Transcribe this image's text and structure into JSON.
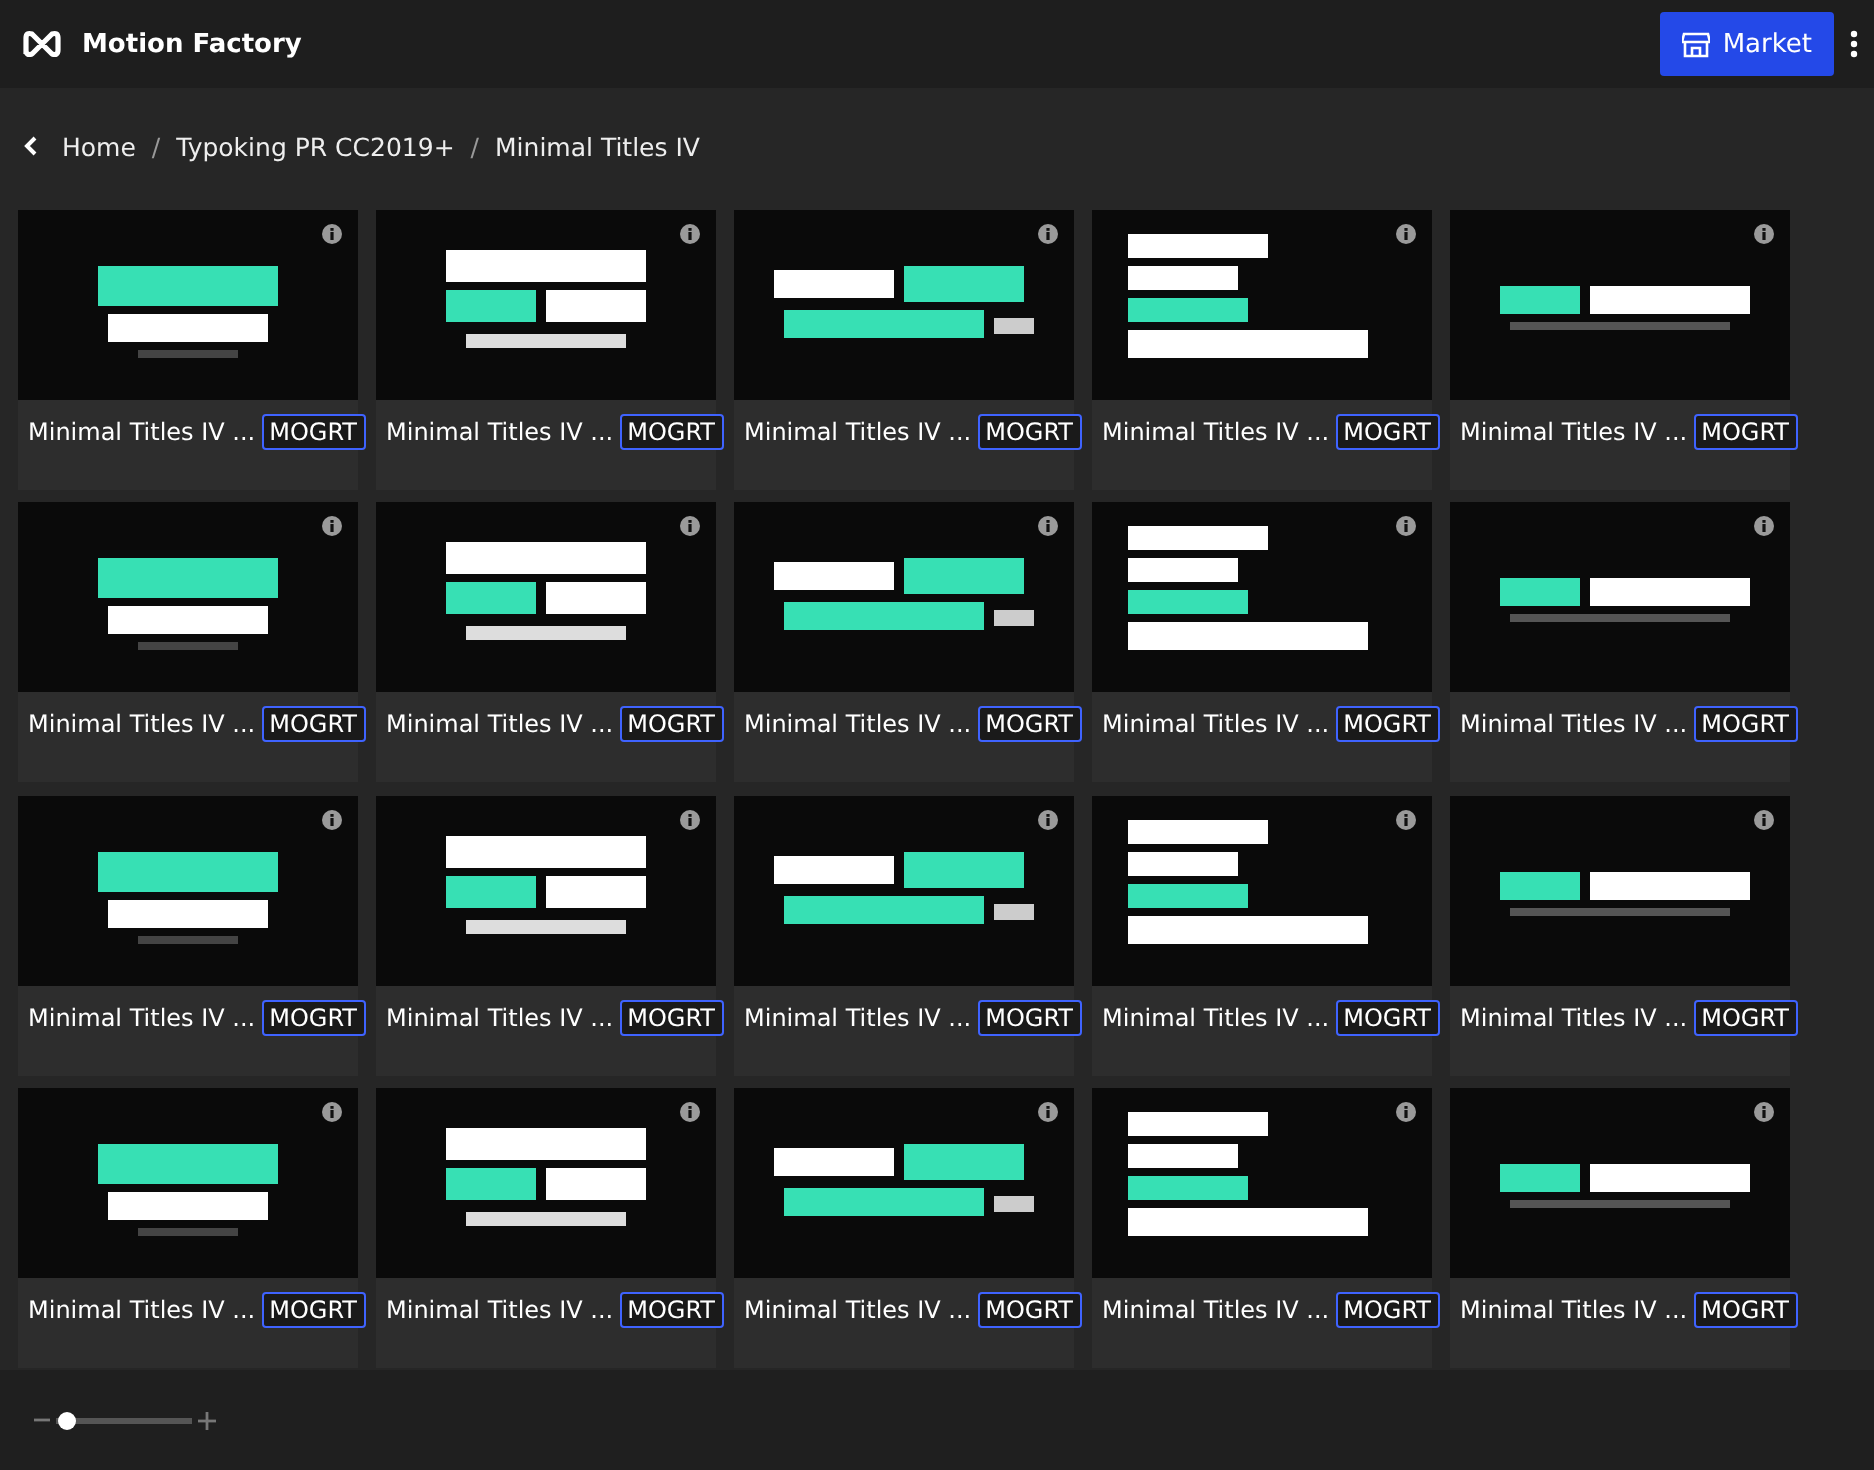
{
  "app": {
    "title": "Motion Factory",
    "market_button": "Market"
  },
  "breadcrumb": {
    "links": [
      "Home",
      "Typoking PR CC2019+",
      "Minimal Titles IV"
    ],
    "separators": [
      "/",
      "/"
    ]
  },
  "items": [
    {
      "title": "Minimal Titles IV ...",
      "badge": "MOGRT"
    },
    {
      "title": "Minimal Titles IV ...",
      "badge": "MOGRT"
    },
    {
      "title": "Minimal Titles IV ...",
      "badge": "MOGRT"
    },
    {
      "title": "Minimal Titles IV ...",
      "badge": "MOGRT"
    },
    {
      "title": "Minimal Titles IV ...",
      "badge": "MOGRT"
    },
    {
      "title": "Minimal Titles IV ...",
      "badge": "MOGRT"
    },
    {
      "title": "Minimal Titles IV ...",
      "badge": "MOGRT"
    },
    {
      "title": "Minimal Titles IV ...",
      "badge": "MOGRT"
    },
    {
      "title": "Minimal Titles IV ...",
      "badge": "MOGRT"
    },
    {
      "title": "Minimal Titles IV ...",
      "badge": "MOGRT"
    },
    {
      "title": "Minimal Titles IV ...",
      "badge": "MOGRT"
    },
    {
      "title": "Minimal Titles IV ...",
      "badge": "MOGRT"
    },
    {
      "title": "Minimal Titles IV ...",
      "badge": "MOGRT"
    },
    {
      "title": "Minimal Titles IV ...",
      "badge": "MOGRT"
    },
    {
      "title": "Minimal Titles IV ...",
      "badge": "MOGRT"
    },
    {
      "title": "Minimal Titles IV ...",
      "badge": "MOGRT"
    },
    {
      "title": "Minimal Titles IV ...",
      "badge": "MOGRT"
    },
    {
      "title": "Minimal Titles IV ...",
      "badge": "MOGRT"
    },
    {
      "title": "Minimal Titles IV ...",
      "badge": "MOGRT"
    },
    {
      "title": "Minimal Titles IV ...",
      "badge": "MOGRT"
    }
  ],
  "zoom_slider": {
    "level": 0.08
  }
}
